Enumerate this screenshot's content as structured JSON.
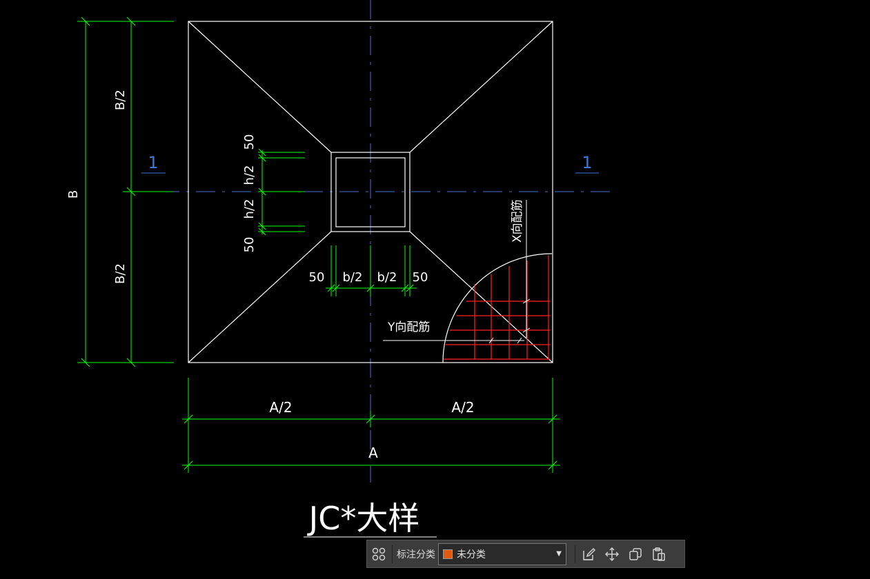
{
  "drawing": {
    "colors": {
      "outline": "#ffffff",
      "dimension": "#00ff00",
      "centerline": "#4a6fcf",
      "rebar": "#ff2020",
      "section_mark": "#3a78d8"
    },
    "dims_left": {
      "total": "B",
      "upper": "B/2",
      "lower": "B/2"
    },
    "dims_bottom": {
      "total": "A",
      "left": "A/2",
      "right": "A/2"
    },
    "dims_column_v": {
      "top_cover": "50",
      "upper_half": "h/2",
      "lower_half": "h/2",
      "bottom_cover": "50"
    },
    "dims_column_h": {
      "left_cover": "50",
      "left_half": "b/2",
      "right_half": "b/2",
      "right_cover": "50"
    },
    "section_marks": {
      "left": "1",
      "right": "1"
    },
    "rebar_labels": {
      "x": "X向配筋",
      "y": "Y向配筋"
    },
    "title": "JC*大样"
  },
  "toolbar": {
    "grid_icon": "grid-icon",
    "label": "标注分类",
    "select_value": "未分类",
    "select_swatch_color": "#e05a10",
    "actions": [
      "edit-icon",
      "move-icon",
      "copy-icon",
      "paste-icon"
    ]
  }
}
